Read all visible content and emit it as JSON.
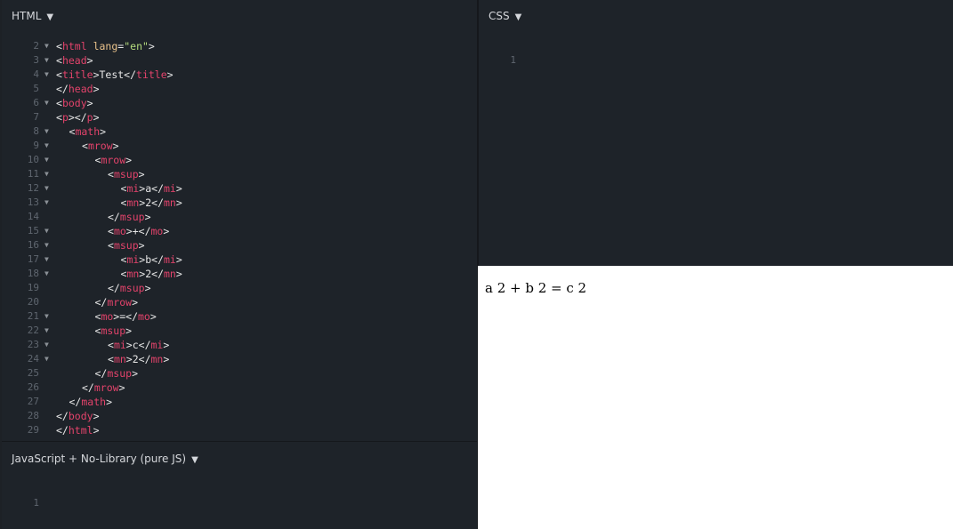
{
  "panels": {
    "html": {
      "title": "HTML",
      "caret": "▼"
    },
    "css": {
      "title": "CSS",
      "caret": "▼",
      "lines": [
        "1"
      ]
    },
    "js": {
      "title": "JavaScript + No-Library (pure JS)",
      "caret": "▼",
      "lines": [
        "1"
      ]
    }
  },
  "html_code": [
    {
      "n": "2",
      "fold": true,
      "indent": 0,
      "parts": [
        [
          "p",
          "<"
        ],
        [
          "t",
          "html"
        ],
        [
          "p",
          " "
        ],
        [
          "a",
          "lang"
        ],
        [
          "p",
          "="
        ],
        [
          "s",
          "\"en\""
        ],
        [
          "p",
          ">"
        ]
      ]
    },
    {
      "n": "3",
      "fold": true,
      "indent": 0,
      "parts": [
        [
          "p",
          "<"
        ],
        [
          "t",
          "head"
        ],
        [
          "p",
          ">"
        ]
      ]
    },
    {
      "n": "4",
      "fold": true,
      "indent": 0,
      "parts": [
        [
          "p",
          "<"
        ],
        [
          "t",
          "title"
        ],
        [
          "p",
          ">Test</"
        ],
        [
          "t",
          "title"
        ],
        [
          "p",
          ">"
        ]
      ]
    },
    {
      "n": "5",
      "fold": false,
      "indent": 0,
      "parts": [
        [
          "p",
          "</"
        ],
        [
          "t",
          "head"
        ],
        [
          "p",
          ">"
        ]
      ]
    },
    {
      "n": "6",
      "fold": true,
      "indent": 0,
      "parts": [
        [
          "p",
          "<"
        ],
        [
          "t",
          "body"
        ],
        [
          "p",
          ">"
        ]
      ]
    },
    {
      "n": "7",
      "fold": false,
      "indent": 0,
      "parts": [
        [
          "p",
          "<"
        ],
        [
          "t",
          "p"
        ],
        [
          "p",
          "></"
        ],
        [
          "t",
          "p"
        ],
        [
          "p",
          ">"
        ]
      ]
    },
    {
      "n": "8",
      "fold": true,
      "indent": 1,
      "parts": [
        [
          "p",
          "<"
        ],
        [
          "t",
          "math"
        ],
        [
          "p",
          ">"
        ]
      ]
    },
    {
      "n": "9",
      "fold": true,
      "indent": 2,
      "parts": [
        [
          "p",
          "<"
        ],
        [
          "t",
          "mrow"
        ],
        [
          "p",
          ">"
        ]
      ]
    },
    {
      "n": "10",
      "fold": true,
      "indent": 3,
      "parts": [
        [
          "p",
          "<"
        ],
        [
          "t",
          "mrow"
        ],
        [
          "p",
          ">"
        ]
      ]
    },
    {
      "n": "11",
      "fold": true,
      "indent": 4,
      "parts": [
        [
          "p",
          "<"
        ],
        [
          "t",
          "msup"
        ],
        [
          "p",
          ">"
        ]
      ]
    },
    {
      "n": "12",
      "fold": true,
      "indent": 5,
      "parts": [
        [
          "p",
          "<"
        ],
        [
          "t",
          "mi"
        ],
        [
          "p",
          ">a</"
        ],
        [
          "t",
          "mi"
        ],
        [
          "p",
          ">"
        ]
      ]
    },
    {
      "n": "13",
      "fold": true,
      "indent": 5,
      "parts": [
        [
          "p",
          "<"
        ],
        [
          "t",
          "mn"
        ],
        [
          "p",
          ">2</"
        ],
        [
          "t",
          "mn"
        ],
        [
          "p",
          ">"
        ]
      ]
    },
    {
      "n": "14",
      "fold": false,
      "indent": 4,
      "parts": [
        [
          "p",
          "</"
        ],
        [
          "t",
          "msup"
        ],
        [
          "p",
          ">"
        ]
      ]
    },
    {
      "n": "15",
      "fold": true,
      "indent": 4,
      "parts": [
        [
          "p",
          "<"
        ],
        [
          "t",
          "mo"
        ],
        [
          "p",
          ">+</"
        ],
        [
          "t",
          "mo"
        ],
        [
          "p",
          ">"
        ]
      ]
    },
    {
      "n": "16",
      "fold": true,
      "indent": 4,
      "parts": [
        [
          "p",
          "<"
        ],
        [
          "t",
          "msup"
        ],
        [
          "p",
          ">"
        ]
      ]
    },
    {
      "n": "17",
      "fold": true,
      "indent": 5,
      "parts": [
        [
          "p",
          "<"
        ],
        [
          "t",
          "mi"
        ],
        [
          "p",
          ">b</"
        ],
        [
          "t",
          "mi"
        ],
        [
          "p",
          ">"
        ]
      ]
    },
    {
      "n": "18",
      "fold": true,
      "indent": 5,
      "parts": [
        [
          "p",
          "<"
        ],
        [
          "t",
          "mn"
        ],
        [
          "p",
          ">2</"
        ],
        [
          "t",
          "mn"
        ],
        [
          "p",
          ">"
        ]
      ]
    },
    {
      "n": "19",
      "fold": false,
      "indent": 4,
      "parts": [
        [
          "p",
          "</"
        ],
        [
          "t",
          "msup"
        ],
        [
          "p",
          ">"
        ]
      ]
    },
    {
      "n": "20",
      "fold": false,
      "indent": 3,
      "parts": [
        [
          "p",
          "</"
        ],
        [
          "t",
          "mrow"
        ],
        [
          "p",
          ">"
        ]
      ]
    },
    {
      "n": "21",
      "fold": true,
      "indent": 3,
      "parts": [
        [
          "p",
          "<"
        ],
        [
          "t",
          "mo"
        ],
        [
          "p",
          ">=</"
        ],
        [
          "t",
          "mo"
        ],
        [
          "p",
          ">"
        ]
      ]
    },
    {
      "n": "22",
      "fold": true,
      "indent": 3,
      "parts": [
        [
          "p",
          "<"
        ],
        [
          "t",
          "msup"
        ],
        [
          "p",
          ">"
        ]
      ]
    },
    {
      "n": "23",
      "fold": true,
      "indent": 4,
      "parts": [
        [
          "p",
          "<"
        ],
        [
          "t",
          "mi"
        ],
        [
          "p",
          ">c</"
        ],
        [
          "t",
          "mi"
        ],
        [
          "p",
          ">"
        ]
      ]
    },
    {
      "n": "24",
      "fold": true,
      "indent": 4,
      "parts": [
        [
          "p",
          "<"
        ],
        [
          "t",
          "mn"
        ],
        [
          "p",
          ">2</"
        ],
        [
          "t",
          "mn"
        ],
        [
          "p",
          ">"
        ]
      ]
    },
    {
      "n": "25",
      "fold": false,
      "indent": 3,
      "parts": [
        [
          "p",
          "</"
        ],
        [
          "t",
          "msup"
        ],
        [
          "p",
          ">"
        ]
      ]
    },
    {
      "n": "26",
      "fold": false,
      "indent": 2,
      "parts": [
        [
          "p",
          "</"
        ],
        [
          "t",
          "mrow"
        ],
        [
          "p",
          ">"
        ]
      ]
    },
    {
      "n": "27",
      "fold": false,
      "indent": 1,
      "parts": [
        [
          "p",
          "</"
        ],
        [
          "t",
          "math"
        ],
        [
          "p",
          ">"
        ]
      ]
    },
    {
      "n": "28",
      "fold": false,
      "indent": 0,
      "parts": [
        [
          "p",
          "</"
        ],
        [
          "t",
          "body"
        ],
        [
          "p",
          ">"
        ]
      ]
    },
    {
      "n": "29",
      "fold": false,
      "indent": 0,
      "parts": [
        [
          "p",
          "</"
        ],
        [
          "t",
          "html"
        ],
        [
          "p",
          ">"
        ]
      ]
    }
  ],
  "result": {
    "text": "a 2 + b 2 = c 2"
  },
  "colors": {
    "editor_bg": "#1e2329",
    "tag": "#e3436b",
    "attr": "#e9c28b",
    "string": "#b5db7d",
    "result_bg": "#ffffff"
  }
}
